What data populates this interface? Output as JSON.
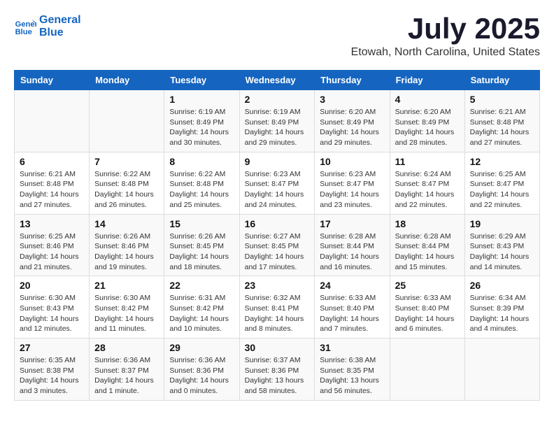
{
  "header": {
    "logo_line1": "General",
    "logo_line2": "Blue",
    "month": "July 2025",
    "location": "Etowah, North Carolina, United States"
  },
  "weekdays": [
    "Sunday",
    "Monday",
    "Tuesday",
    "Wednesday",
    "Thursday",
    "Friday",
    "Saturday"
  ],
  "weeks": [
    [
      {
        "day": "",
        "info": ""
      },
      {
        "day": "",
        "info": ""
      },
      {
        "day": "1",
        "info": "Sunrise: 6:19 AM\nSunset: 8:49 PM\nDaylight: 14 hours\nand 30 minutes."
      },
      {
        "day": "2",
        "info": "Sunrise: 6:19 AM\nSunset: 8:49 PM\nDaylight: 14 hours\nand 29 minutes."
      },
      {
        "day": "3",
        "info": "Sunrise: 6:20 AM\nSunset: 8:49 PM\nDaylight: 14 hours\nand 29 minutes."
      },
      {
        "day": "4",
        "info": "Sunrise: 6:20 AM\nSunset: 8:49 PM\nDaylight: 14 hours\nand 28 minutes."
      },
      {
        "day": "5",
        "info": "Sunrise: 6:21 AM\nSunset: 8:48 PM\nDaylight: 14 hours\nand 27 minutes."
      }
    ],
    [
      {
        "day": "6",
        "info": "Sunrise: 6:21 AM\nSunset: 8:48 PM\nDaylight: 14 hours\nand 27 minutes."
      },
      {
        "day": "7",
        "info": "Sunrise: 6:22 AM\nSunset: 8:48 PM\nDaylight: 14 hours\nand 26 minutes."
      },
      {
        "day": "8",
        "info": "Sunrise: 6:22 AM\nSunset: 8:48 PM\nDaylight: 14 hours\nand 25 minutes."
      },
      {
        "day": "9",
        "info": "Sunrise: 6:23 AM\nSunset: 8:47 PM\nDaylight: 14 hours\nand 24 minutes."
      },
      {
        "day": "10",
        "info": "Sunrise: 6:23 AM\nSunset: 8:47 PM\nDaylight: 14 hours\nand 23 minutes."
      },
      {
        "day": "11",
        "info": "Sunrise: 6:24 AM\nSunset: 8:47 PM\nDaylight: 14 hours\nand 22 minutes."
      },
      {
        "day": "12",
        "info": "Sunrise: 6:25 AM\nSunset: 8:47 PM\nDaylight: 14 hours\nand 22 minutes."
      }
    ],
    [
      {
        "day": "13",
        "info": "Sunrise: 6:25 AM\nSunset: 8:46 PM\nDaylight: 14 hours\nand 21 minutes."
      },
      {
        "day": "14",
        "info": "Sunrise: 6:26 AM\nSunset: 8:46 PM\nDaylight: 14 hours\nand 19 minutes."
      },
      {
        "day": "15",
        "info": "Sunrise: 6:26 AM\nSunset: 8:45 PM\nDaylight: 14 hours\nand 18 minutes."
      },
      {
        "day": "16",
        "info": "Sunrise: 6:27 AM\nSunset: 8:45 PM\nDaylight: 14 hours\nand 17 minutes."
      },
      {
        "day": "17",
        "info": "Sunrise: 6:28 AM\nSunset: 8:44 PM\nDaylight: 14 hours\nand 16 minutes."
      },
      {
        "day": "18",
        "info": "Sunrise: 6:28 AM\nSunset: 8:44 PM\nDaylight: 14 hours\nand 15 minutes."
      },
      {
        "day": "19",
        "info": "Sunrise: 6:29 AM\nSunset: 8:43 PM\nDaylight: 14 hours\nand 14 minutes."
      }
    ],
    [
      {
        "day": "20",
        "info": "Sunrise: 6:30 AM\nSunset: 8:43 PM\nDaylight: 14 hours\nand 12 minutes."
      },
      {
        "day": "21",
        "info": "Sunrise: 6:30 AM\nSunset: 8:42 PM\nDaylight: 14 hours\nand 11 minutes."
      },
      {
        "day": "22",
        "info": "Sunrise: 6:31 AM\nSunset: 8:42 PM\nDaylight: 14 hours\nand 10 minutes."
      },
      {
        "day": "23",
        "info": "Sunrise: 6:32 AM\nSunset: 8:41 PM\nDaylight: 14 hours\nand 8 minutes."
      },
      {
        "day": "24",
        "info": "Sunrise: 6:33 AM\nSunset: 8:40 PM\nDaylight: 14 hours\nand 7 minutes."
      },
      {
        "day": "25",
        "info": "Sunrise: 6:33 AM\nSunset: 8:40 PM\nDaylight: 14 hours\nand 6 minutes."
      },
      {
        "day": "26",
        "info": "Sunrise: 6:34 AM\nSunset: 8:39 PM\nDaylight: 14 hours\nand 4 minutes."
      }
    ],
    [
      {
        "day": "27",
        "info": "Sunrise: 6:35 AM\nSunset: 8:38 PM\nDaylight: 14 hours\nand 3 minutes."
      },
      {
        "day": "28",
        "info": "Sunrise: 6:36 AM\nSunset: 8:37 PM\nDaylight: 14 hours\nand 1 minute."
      },
      {
        "day": "29",
        "info": "Sunrise: 6:36 AM\nSunset: 8:36 PM\nDaylight: 14 hours\nand 0 minutes."
      },
      {
        "day": "30",
        "info": "Sunrise: 6:37 AM\nSunset: 8:36 PM\nDaylight: 13 hours\nand 58 minutes."
      },
      {
        "day": "31",
        "info": "Sunrise: 6:38 AM\nSunset: 8:35 PM\nDaylight: 13 hours\nand 56 minutes."
      },
      {
        "day": "",
        "info": ""
      },
      {
        "day": "",
        "info": ""
      }
    ]
  ]
}
